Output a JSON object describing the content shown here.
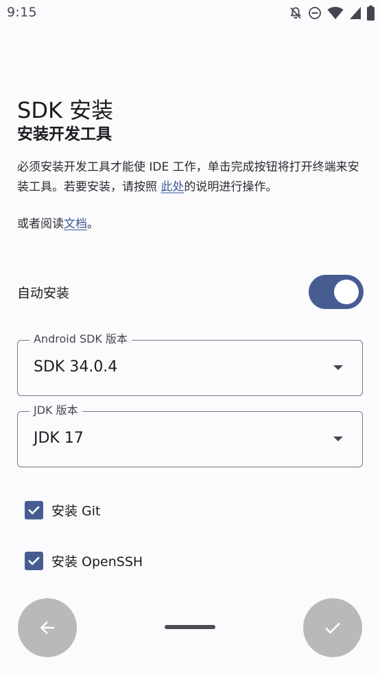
{
  "status_bar": {
    "time": "9:15",
    "icons": [
      "notifications-off-icon",
      "do-not-disturb-icon",
      "wifi-icon",
      "cellular-signal-icon",
      "battery-icon"
    ]
  },
  "page": {
    "title": "SDK 安装",
    "subtitle": "安装开发工具",
    "description_before_link": "必须安装开发工具才能使 IDE 工作，单击完成按钮将打开终端来安装工具。若要安装，请按照 ",
    "description_link": "此处",
    "description_after_link": "的说明进行操作。",
    "docs_prefix": "或者阅读",
    "docs_link": "文档",
    "docs_suffix": "。"
  },
  "auto_install": {
    "label": "自动安装",
    "enabled": true
  },
  "fields": {
    "android_sdk": {
      "label": "Android SDK 版本",
      "value": "SDK 34.0.4"
    },
    "jdk": {
      "label": "JDK 版本",
      "value": "JDK 17"
    }
  },
  "checkboxes": [
    {
      "label": "安装 Git",
      "checked": true
    },
    {
      "label": "安装 OpenSSH",
      "checked": true
    }
  ],
  "navigation": {
    "back_icon": "arrow-back-icon",
    "done_icon": "check-icon"
  },
  "colors": {
    "accent": "#475d92",
    "link": "#3b5a94",
    "fab": "#b9b9bb"
  }
}
